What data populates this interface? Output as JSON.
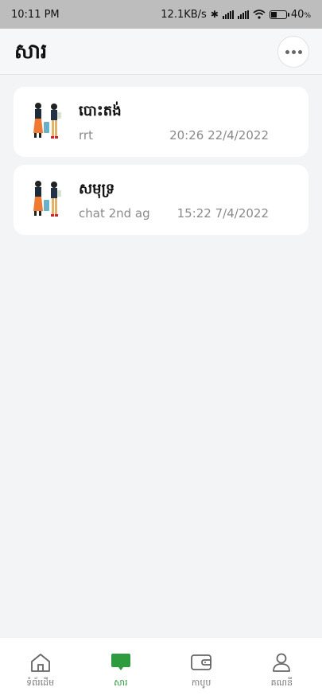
{
  "status_bar": {
    "time": "10:11 PM",
    "speed": "12.1KB/s",
    "battery": "40",
    "battery_unit": "%",
    "battery_level_percent": 40
  },
  "header": {
    "title": "សារ"
  },
  "messages": [
    {
      "title": "បោះតង់",
      "preview": "rrt",
      "time": "20:26 22/4/2022"
    },
    {
      "title": "សមុទ្រ",
      "preview": "chat 2nd ag",
      "time": "15:22 7/4/2022"
    }
  ],
  "tabs": [
    {
      "label": "ទំព័រដើម",
      "icon": "home-icon"
    },
    {
      "label": "សារ",
      "icon": "chat-icon",
      "active": true
    },
    {
      "label": "កាបូប",
      "icon": "wallet-icon"
    },
    {
      "label": "គណនី",
      "icon": "user-icon"
    }
  ],
  "colors": {
    "accent": "#2e9b3e",
    "status_bar": "#bdbdbd",
    "background": "#f3f4f6"
  }
}
